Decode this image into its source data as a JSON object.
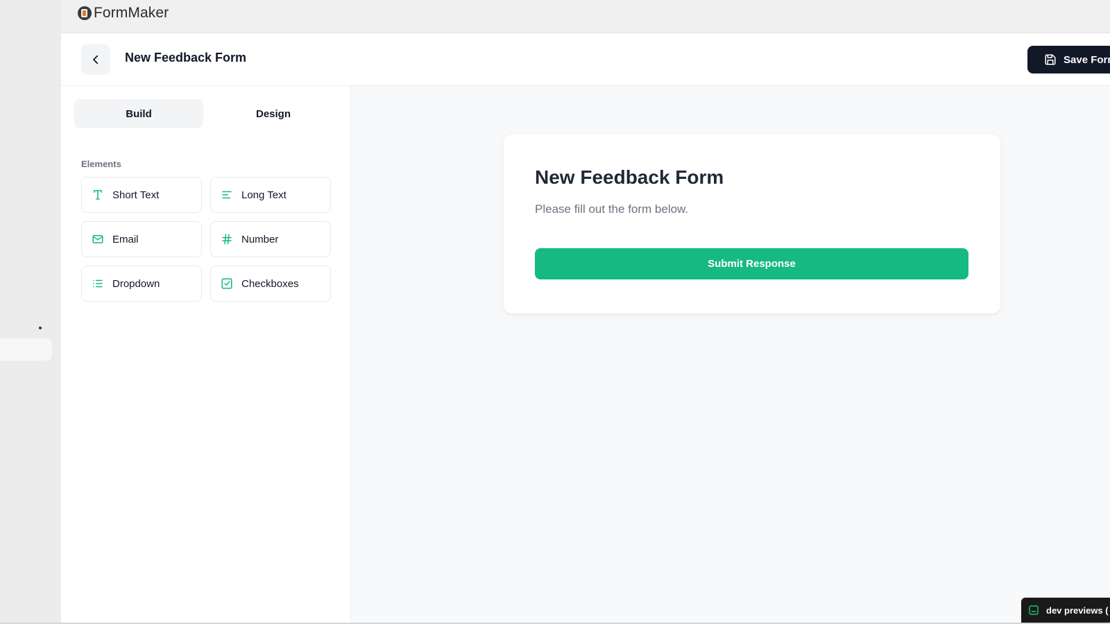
{
  "app": {
    "name": "FormMaker"
  },
  "header": {
    "title": "New Feedback Form",
    "save_label": "Save Form"
  },
  "sidebar": {
    "tabs": [
      {
        "label": "Build",
        "active": true
      },
      {
        "label": "Design",
        "active": false
      }
    ],
    "section_label": "Elements",
    "elements": [
      {
        "label": "Short Text",
        "icon": "type-icon"
      },
      {
        "label": "Long Text",
        "icon": "align-left-icon"
      },
      {
        "label": "Email",
        "icon": "mail-icon"
      },
      {
        "label": "Number",
        "icon": "hash-icon"
      },
      {
        "label": "Dropdown",
        "icon": "list-icon"
      },
      {
        "label": "Checkboxes",
        "icon": "check-square-icon"
      }
    ]
  },
  "form": {
    "title": "New Feedback Form",
    "description": "Please fill out the form below.",
    "submit_label": "Submit Response"
  },
  "dev_badge": {
    "label": "dev previews ("
  },
  "colors": {
    "accent": "#16b981",
    "dark": "#111827",
    "muted": "#6b7280"
  }
}
